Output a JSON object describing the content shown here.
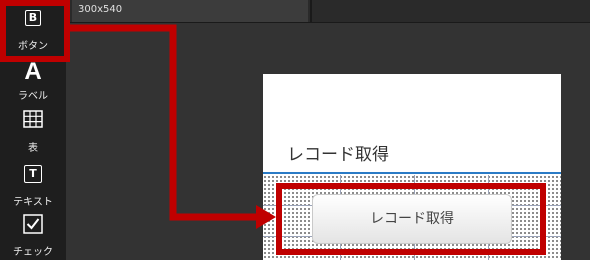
{
  "toolbox": {
    "items": [
      {
        "icon": "button-icon",
        "glyph": "B",
        "label": "ボタン"
      },
      {
        "icon": "label-icon",
        "glyph": "A",
        "label": "ラベル"
      },
      {
        "icon": "table-icon",
        "glyph": "",
        "label": "表"
      },
      {
        "icon": "text-icon",
        "glyph": "T",
        "label": "テキスト"
      },
      {
        "icon": "check-icon",
        "glyph": "",
        "label": "チェック"
      }
    ]
  },
  "tab": {
    "label": "300x540"
  },
  "device": {
    "title": "レコード取得",
    "button_label": "レコード取得"
  },
  "colors": {
    "highlight": "#c00000",
    "accent_rule": "#2a7bc6"
  }
}
